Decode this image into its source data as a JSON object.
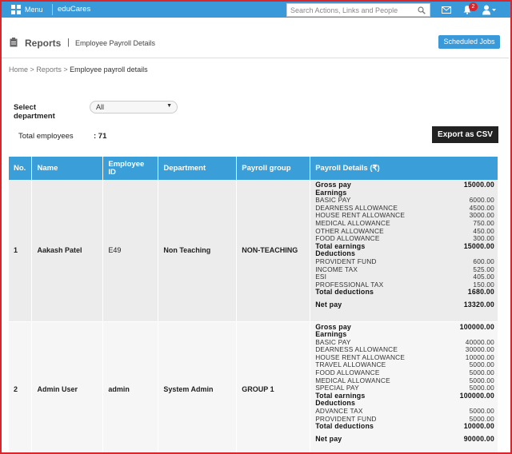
{
  "topbar": {
    "menu_label": "Menu",
    "brand": "eduCares",
    "search_placeholder": "Search Actions, Links and People",
    "notification_count": "2"
  },
  "header": {
    "title": "Reports",
    "separator": "|",
    "subtitle": "Employee Payroll Details",
    "scheduled_jobs_label": "Scheduled Jobs"
  },
  "breadcrumb": {
    "home": "Home",
    "sep1": ">",
    "reports": "Reports",
    "sep2": ">",
    "current": "Employee payroll details"
  },
  "filter": {
    "label_line1": "Select",
    "label_line2": "department",
    "selected": "All"
  },
  "summary": {
    "total_label": "Total employees",
    "total_value": ": 71",
    "export_label": "Export as CSV"
  },
  "table": {
    "headers": {
      "no": "No.",
      "name": "Name",
      "emp_id_1": "Employee",
      "emp_id_2": "ID",
      "department": "Department",
      "payroll_group": "Payroll group",
      "payroll_details": "Payroll Details (₹)"
    },
    "rows": [
      {
        "no": "1",
        "name": "Aakash Patel",
        "emp_id": "E49",
        "department": "Non Teaching",
        "group": "NON-TEACHING",
        "details": [
          {
            "label": "Gross pay",
            "value": "15000.00",
            "bold": true
          },
          {
            "label": "Earnings",
            "value": "",
            "bold": true
          },
          {
            "label": "BASIC PAY",
            "value": "6000.00"
          },
          {
            "label": "DEARNESS ALLOWANCE",
            "value": "4500.00"
          },
          {
            "label": "HOUSE RENT ALLOWANCE",
            "value": "3000.00"
          },
          {
            "label": "MEDICAL ALLOWANCE",
            "value": "750.00"
          },
          {
            "label": "OTHER ALLOWANCE",
            "value": "450.00"
          },
          {
            "label": "FOOD ALLOWANCE",
            "value": "300.00"
          },
          {
            "label": "Total earnings",
            "value": "15000.00",
            "bold": true
          },
          {
            "label": "Deductions",
            "value": "",
            "bold": true
          },
          {
            "label": "PROVIDENT FUND",
            "value": "600.00"
          },
          {
            "label": "INCOME TAX",
            "value": "525.00"
          },
          {
            "label": "ESI",
            "value": "405.00"
          },
          {
            "label": "PROFESSIONAL TAX",
            "value": "150.00"
          },
          {
            "label": "Total deductions",
            "value": "1680.00",
            "bold": true
          },
          {
            "label": "",
            "value": "",
            "gap": true
          },
          {
            "label": "Net pay",
            "value": "13320.00",
            "bold": true
          }
        ]
      },
      {
        "no": "2",
        "name": "Admin User",
        "emp_id": "admin",
        "department": "System Admin",
        "group": "GROUP 1",
        "details": [
          {
            "label": "Gross pay",
            "value": "100000.00",
            "bold": true
          },
          {
            "label": "Earnings",
            "value": "",
            "bold": true
          },
          {
            "label": "BASIC PAY",
            "value": "40000.00"
          },
          {
            "label": "DEARNESS ALLOWANCE",
            "value": "30000.00"
          },
          {
            "label": "HOUSE RENT ALLOWANCE",
            "value": "10000.00"
          },
          {
            "label": "TRAVEL ALLOWANCE",
            "value": "5000.00"
          },
          {
            "label": "FOOD ALLOWANCE",
            "value": "5000.00"
          },
          {
            "label": "MEDICAL ALLOWANCE",
            "value": "5000.00"
          },
          {
            "label": "SPECIAL PAY",
            "value": "5000.00"
          },
          {
            "label": "Total earnings",
            "value": "100000.00",
            "bold": true
          },
          {
            "label": "Deductions",
            "value": "",
            "bold": true
          },
          {
            "label": "ADVANCE TAX",
            "value": "5000.00"
          },
          {
            "label": "PROVIDENT FUND",
            "value": "5000.00"
          },
          {
            "label": "Total deductions",
            "value": "10000.00",
            "bold": true
          },
          {
            "label": "",
            "value": "",
            "gap": true
          },
          {
            "label": "Net pay",
            "value": "90000.00",
            "bold": true
          }
        ]
      }
    ]
  },
  "colors": {
    "accent": "#3a99d8",
    "frame": "#d9262c",
    "export_button": "#222222"
  },
  "icons": [
    "grid-icon",
    "search-icon",
    "mail-icon",
    "bell-icon",
    "user-icon",
    "clipboard-icon",
    "caret-down-icon"
  ]
}
